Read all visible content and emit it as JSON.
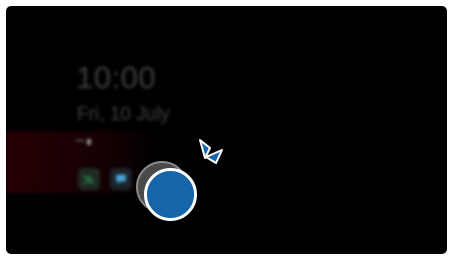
{
  "lockscreen": {
    "time": "10:00",
    "date": "Fri, 10 July",
    "battery": "••••"
  },
  "notifications": [
    {
      "icon": "missed-call-icon",
      "color": "#2e9e57"
    },
    {
      "icon": "message-icon",
      "color": "#4aa3d9"
    }
  ],
  "gesture": {
    "type": "double-tap",
    "circle_color": "#1565a8",
    "accent_color": "#1565a8"
  }
}
